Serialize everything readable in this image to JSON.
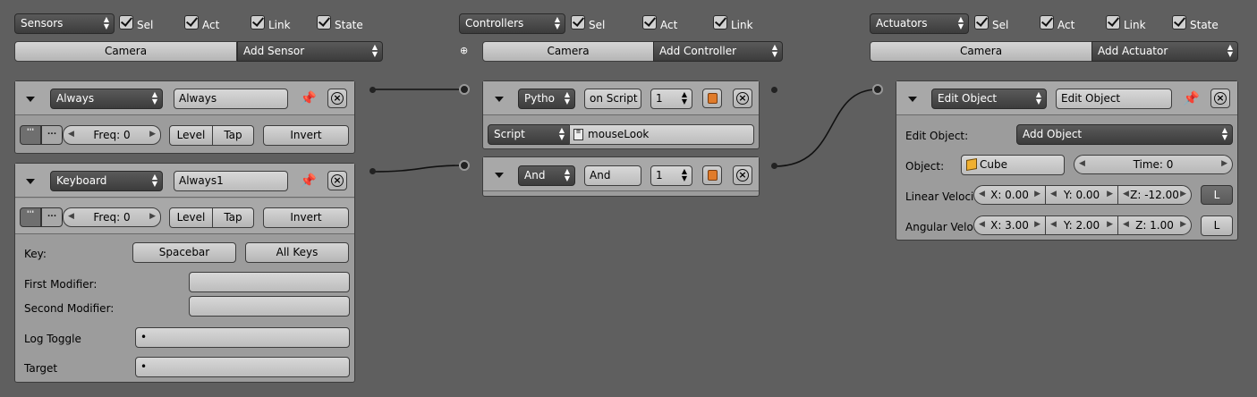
{
  "sensors": {
    "menu": "Sensors",
    "checks": [
      {
        "label": "Sel"
      },
      {
        "label": "Act"
      },
      {
        "label": "Link"
      },
      {
        "label": "State"
      }
    ],
    "object_btn": "Camera",
    "add_btn": "Add Sensor",
    "bricks": [
      {
        "type": "Always",
        "name": "Always",
        "pulse_a": "'''",
        "pulse_b": "...",
        "freq": "Freq: 0",
        "level": "Level",
        "tap": "Tap",
        "invert": "Invert"
      },
      {
        "type": "Keyboard",
        "name": "Always1",
        "pulse_a": "'''",
        "pulse_b": "...",
        "freq": "Freq: 0",
        "level": "Level",
        "tap": "Tap",
        "invert": "Invert",
        "key_label": "Key:",
        "key_value": "Spacebar",
        "all_keys": "All Keys",
        "first_modifier_label": "First Modifier:",
        "second_modifier_label": "Second Modifier:",
        "log_toggle_label": "Log Toggle",
        "log_toggle_value": "•",
        "target_label": "Target",
        "target_value": "•"
      }
    ]
  },
  "controllers": {
    "menu": "Controllers",
    "checks": [
      {
        "label": "Sel"
      },
      {
        "label": "Act"
      },
      {
        "label": "Link"
      }
    ],
    "object_btn": "Camera",
    "add_btn": "Add Controller",
    "bricks": [
      {
        "type": "Pytho",
        "name": "on Script",
        "state": "1",
        "mode": "Script",
        "script": "mouseLook"
      },
      {
        "type": "And",
        "name": "And",
        "state": "1"
      }
    ]
  },
  "actuators": {
    "menu": "Actuators",
    "checks": [
      {
        "label": "Sel"
      },
      {
        "label": "Act"
      },
      {
        "label": "Link"
      },
      {
        "label": "State"
      }
    ],
    "object_btn": "Camera",
    "add_btn": "Add Actuator",
    "bricks": [
      {
        "type": "Edit Object",
        "name": "Edit Object",
        "edit_label": "Edit Object:",
        "edit_value": "Add Object",
        "object_label": "Object:",
        "object_value": "Cube",
        "time": "Time: 0",
        "linear_label": "Linear Velocit",
        "linear": [
          "X: 0.00",
          "Y: 0.00",
          "Z: -12.00"
        ],
        "linear_local": "L",
        "angular_label": "Angular Veloc",
        "angular": [
          "X: 3.00",
          "Y: 2.00",
          "Z: 1.00"
        ],
        "angular_local": "L"
      }
    ]
  },
  "colors": {
    "background": "#5f5f5f",
    "panel": "#9c9c9c",
    "dropdown": "#3c3c3c",
    "link_line": "#111111"
  }
}
